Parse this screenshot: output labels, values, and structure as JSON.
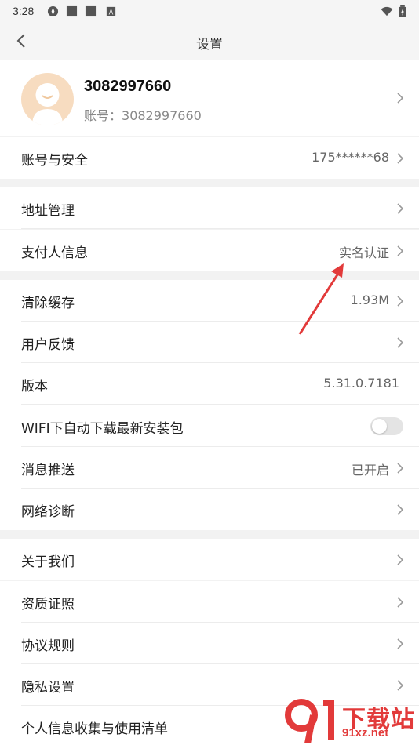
{
  "status_bar": {
    "time": "3:28"
  },
  "nav": {
    "title": "设置"
  },
  "profile": {
    "name": "3082997660",
    "account_label": "账号：",
    "account_value": "3082997660"
  },
  "rows": {
    "account_security": {
      "label": "账号与安全",
      "value": "175******68"
    },
    "address": {
      "label": "地址管理"
    },
    "payer_info": {
      "label": "支付人信息",
      "value": "实名认证"
    },
    "clear_cache": {
      "label": "清除缓存",
      "value": "1.93M"
    },
    "feedback": {
      "label": "用户反馈"
    },
    "version": {
      "label": "版本",
      "value": "5.31.0.7181"
    },
    "wifi_download": {
      "label": "WIFI下自动下载最新安装包",
      "toggle_on": false
    },
    "push": {
      "label": "消息推送",
      "value": "已开启"
    },
    "network": {
      "label": "网络诊断"
    },
    "about": {
      "label": "关于我们"
    },
    "qualification": {
      "label": "资质证照"
    },
    "agreement": {
      "label": "协议规则"
    },
    "privacy": {
      "label": "隐私设置"
    },
    "personal_info": {
      "label": "个人信息收集与使用清单"
    }
  },
  "watermark": {
    "brand": "下载站",
    "url": "91xz.net"
  },
  "colors": {
    "accent_red": "#e23a3a",
    "divider": "#ececec",
    "background": "#f2f2f2"
  }
}
